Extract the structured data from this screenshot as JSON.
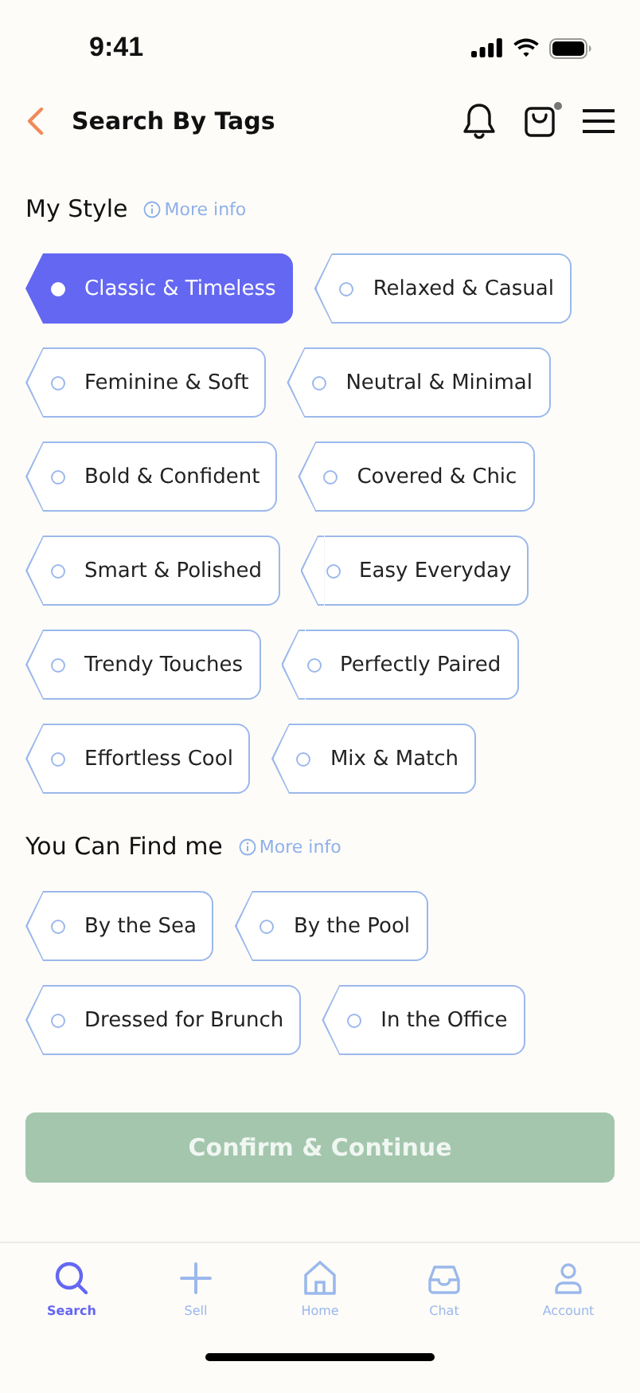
{
  "status_bar": {
    "time": "9:41"
  },
  "header": {
    "title": "Search By Tags",
    "cart_badge": true
  },
  "sections": [
    {
      "title": "My Style",
      "info": "More info",
      "tags": [
        {
          "label": "Classic & Timeless",
          "selected": true
        },
        {
          "label": "Relaxed & Casual",
          "selected": false
        },
        {
          "label": "Feminine & Soft",
          "selected": false
        },
        {
          "label": "Neutral & Minimal",
          "selected": false
        },
        {
          "label": "Bold & Confident",
          "selected": false
        },
        {
          "label": "Covered & Chic",
          "selected": false
        },
        {
          "label": "Smart & Polished",
          "selected": false
        },
        {
          "label": "Easy Everyday",
          "selected": false
        },
        {
          "label": "Trendy Touches",
          "selected": false
        },
        {
          "label": "Perfectly Paired",
          "selected": false
        },
        {
          "label": "Effortless Cool",
          "selected": false
        },
        {
          "label": "Mix & Match",
          "selected": false
        }
      ]
    },
    {
      "title": "You Can Find me",
      "info": "More info",
      "tags": [
        {
          "label": "By the Sea",
          "selected": false
        },
        {
          "label": "By the Pool",
          "selected": false
        },
        {
          "label": "Dressed for Brunch",
          "selected": false
        },
        {
          "label": "In the Office",
          "selected": false
        }
      ]
    }
  ],
  "confirm": {
    "label": "Confirm & Continue",
    "disabled": true
  },
  "tab_bar": [
    {
      "kind": "search",
      "label": "Search",
      "selected": true
    },
    {
      "kind": "sell",
      "label": "Sell",
      "selected": false
    },
    {
      "kind": "home",
      "label": "Home",
      "selected": false
    },
    {
      "kind": "chat",
      "label": "Chat",
      "selected": false
    },
    {
      "kind": "account",
      "label": "Account",
      "selected": false
    }
  ]
}
